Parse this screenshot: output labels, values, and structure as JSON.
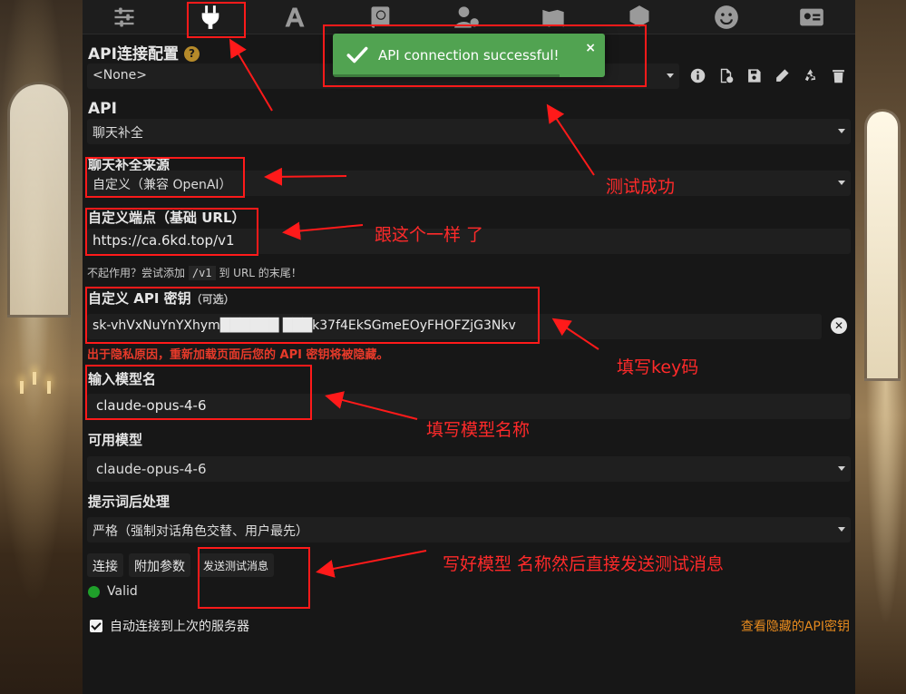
{
  "toast": {
    "message": "API connection successful!",
    "close": "×"
  },
  "sections": {
    "api_config_title": "API连接配置",
    "api_config_help": "?",
    "profile_select": "<None>",
    "api_label": "API",
    "api_value": "聊天补全",
    "source_label": "聊天补全来源",
    "source_value": "自定义（兼容 OpenAI）",
    "endpoint_label": "自定义端点（基础 URL）",
    "endpoint_value": "https://ca.6kd.top/v1",
    "endpoint_note_prefix": "不起作用？尝试添加",
    "endpoint_note_code": "/v1",
    "endpoint_note_suffix": "到 URL 的末尾！",
    "key_label": "自定义 API 密钥",
    "key_optional": "（可选）",
    "key_value": "sk-vhVxNuYnYXhym██████ ███k37f4EkSGmeEOyFHOFZjG3Nkv",
    "key_warning": "出于隐私原因，重新加载页面后您的 API 密钥将被隐藏。",
    "model_input_label": "输入模型名",
    "model_input_value": "claude-opus-4-6",
    "available_label": "可用模型",
    "available_value": "claude-opus-4-6",
    "postproc_label": "提示词后处理",
    "postproc_value": "严格（强制对话角色交替、用户最先）"
  },
  "buttons": {
    "connect": "连接",
    "extra_params": "附加参数",
    "send_test": "发送测试消息"
  },
  "status": {
    "text": "Valid",
    "color": "#1fa02a"
  },
  "auto_connect": {
    "label": "自动连接到上次的服务器",
    "checked": true
  },
  "view_hidden_keys": "查看隐藏的API密钥",
  "annotations": {
    "test_success": "测试成功",
    "same_as_this": "跟这个一样 了",
    "fill_key": "填写key码",
    "fill_model": "填写模型名称",
    "send_after": "写好模型 名称然后直接发送测试消息"
  },
  "colors": {
    "accent_red": "#ff1a1a",
    "toast_green": "#51a351",
    "link_orange": "#e68a1e"
  }
}
